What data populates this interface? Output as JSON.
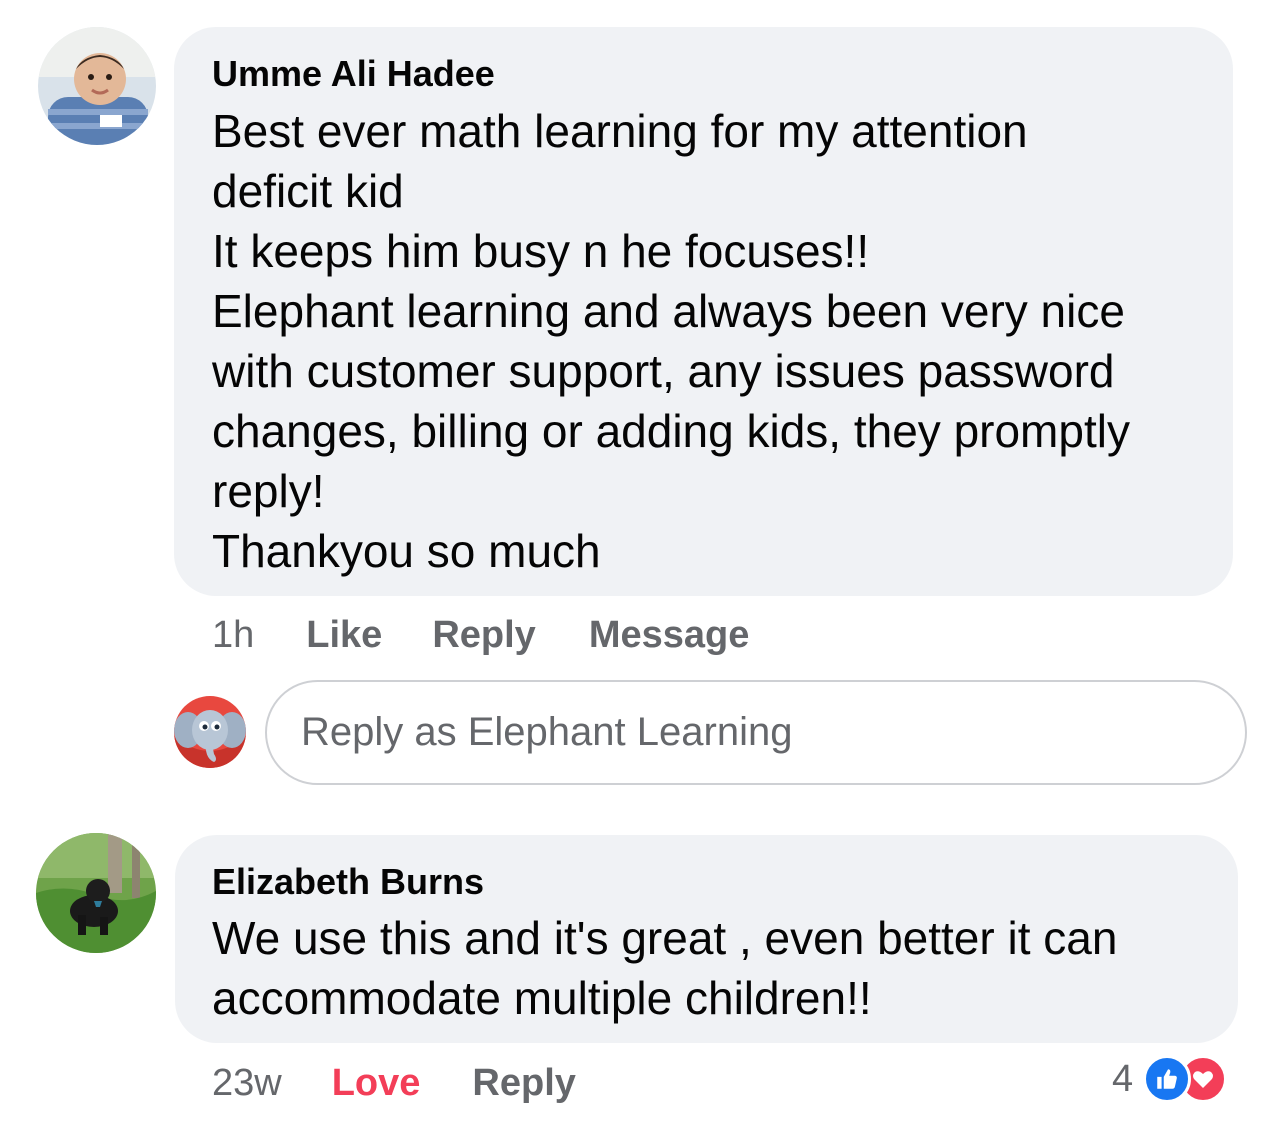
{
  "comments": [
    {
      "author": "Umme Ali Hadee",
      "text": "Best ever math learning for my attention\ndeficit kid\nIt keeps him busy n he focuses!!\nElephant learning and always been very nice\nwith customer support, any issues password\nchanges, billing or adding kids, they promptly\nreply!\nThankyou so much",
      "time": "1h",
      "actions": {
        "like": "Like",
        "reply": "Reply",
        "message": "Message"
      }
    },
    {
      "author": "Elizabeth Burns",
      "text": "We use this and it's great , even  better  it can\naccommodate multiple children!!",
      "time": "23w",
      "actions": {
        "love": "Love",
        "reply": "Reply"
      },
      "reactions": {
        "count": "4",
        "icons": [
          "like-icon",
          "love-icon"
        ]
      }
    }
  ],
  "reply_input": {
    "placeholder": "Reply as Elephant Learning",
    "value": ""
  },
  "colors": {
    "bubble": "#f0f2f5",
    "meta": "#65676b",
    "love": "#f33e58",
    "like_blue": "#1877f2"
  }
}
